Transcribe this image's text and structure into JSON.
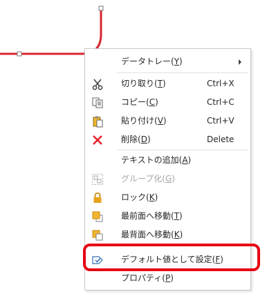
{
  "context_menu": {
    "items": [
      {
        "key": "datatray",
        "label": "データトレー(",
        "mnemonic": "Y",
        "suffix": ")",
        "shortcut": "",
        "icon": "",
        "submenu": true,
        "disabled": false
      },
      {
        "key": "cut",
        "label": "切り取り(",
        "mnemonic": "T",
        "suffix": ")",
        "shortcut": "Ctrl+X",
        "icon": "scissors-icon",
        "submenu": false,
        "disabled": false
      },
      {
        "key": "copy",
        "label": "コピー(",
        "mnemonic": "C",
        "suffix": ")",
        "shortcut": "Ctrl+C",
        "icon": "copy-icon",
        "submenu": false,
        "disabled": false
      },
      {
        "key": "paste",
        "label": "貼り付け(",
        "mnemonic": "V",
        "suffix": ")",
        "shortcut": "Ctrl+V",
        "icon": "paste-icon",
        "submenu": false,
        "disabled": false
      },
      {
        "key": "delete",
        "label": "削除(",
        "mnemonic": "D",
        "suffix": ")",
        "shortcut": "Delete",
        "icon": "delete-icon",
        "submenu": false,
        "disabled": false
      },
      {
        "key": "add_text",
        "label": "テキストの追加(",
        "mnemonic": "A",
        "suffix": ")",
        "shortcut": "",
        "icon": "",
        "submenu": false,
        "disabled": false
      },
      {
        "key": "group",
        "label": "グループ化(",
        "mnemonic": "G",
        "suffix": ")",
        "shortcut": "",
        "icon": "group-icon",
        "submenu": false,
        "disabled": true
      },
      {
        "key": "lock",
        "label": "ロック(",
        "mnemonic": "K",
        "suffix": ")",
        "shortcut": "",
        "icon": "lock-icon",
        "submenu": false,
        "disabled": false
      },
      {
        "key": "bring_front",
        "label": "最前面へ移動(",
        "mnemonic": "T",
        "suffix": ")",
        "shortcut": "",
        "icon": "bring-to-front-icon",
        "submenu": false,
        "disabled": false
      },
      {
        "key": "send_back",
        "label": "最背面へ移動(",
        "mnemonic": "K",
        "suffix": ")",
        "shortcut": "",
        "icon": "send-to-back-icon",
        "submenu": false,
        "disabled": false
      },
      {
        "key": "set_default",
        "label": "デフォルト値として設定(",
        "mnemonic": "F",
        "suffix": ")",
        "shortcut": "",
        "icon": "set-default-icon",
        "submenu": false,
        "disabled": false
      },
      {
        "key": "properties",
        "label": "プロパティ(",
        "mnemonic": "P",
        "suffix": ")",
        "shortcut": "",
        "icon": "",
        "submenu": false,
        "disabled": false
      }
    ]
  },
  "colors": {
    "connector": "#d7262e",
    "highlight": "#e60012",
    "delete_icon": "#e3242b",
    "lock_icon": "#e6a11c",
    "arrange_icon": "#f2b531"
  }
}
